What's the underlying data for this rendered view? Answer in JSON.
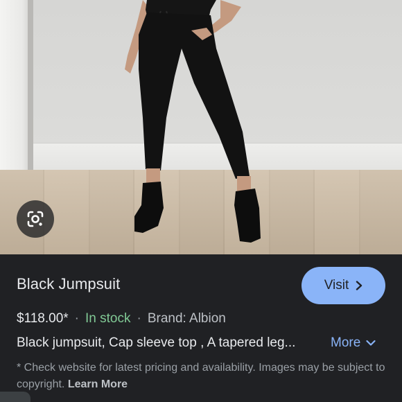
{
  "product": {
    "title": "Black Jumpsuit",
    "price": "$118.00*",
    "stock_status": "In stock",
    "brand": "Brand: Albion",
    "separator": "·",
    "description": "Black jumpsuit, Cap sleeve top , A tapered leg...",
    "more_label": "More"
  },
  "actions": {
    "visit_label": "Visit"
  },
  "disclaimer": {
    "text": "* Check website for latest pricing and availability. Images may be subject to copyright.",
    "learn_more": "Learn More"
  },
  "icons": {
    "lens": "google-lens-icon",
    "visit_chevron": "chevron-right-icon",
    "more_chevron": "chevron-down-icon"
  },
  "colors": {
    "panel_bg": "#202124",
    "accent": "#8ab4f8",
    "in_stock": "#81c995",
    "primary_text": "#e8eaed",
    "secondary_text": "#9aa0a6"
  }
}
